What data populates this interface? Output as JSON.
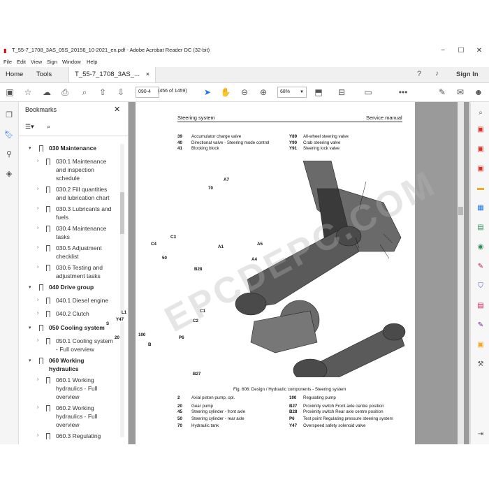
{
  "window": {
    "title": "T_55-7_1708_3AS_05S_20156_10-2021_en.pdf - Adobe Acrobat Reader DC (32-bit)",
    "minimize": "−",
    "maximize": "☐",
    "close": "✕"
  },
  "menu": [
    "File",
    "Edit",
    "View",
    "Sign",
    "Window",
    "Help"
  ],
  "tabs": {
    "home": "Home",
    "tools": "Tools",
    "doc": "T_55-7_1708_3AS_...",
    "doc_close": "×",
    "sign_in": "Sign In"
  },
  "toolbar": {
    "page_num": "090-4",
    "page_count": "(456 of 1459)",
    "zoom": "68%"
  },
  "bookmarks": {
    "title": "Bookmarks",
    "items": [
      {
        "label": "030 Maintenance",
        "level": 1
      },
      {
        "label": "030.1 Maintenance and inspection schedule",
        "level": 2
      },
      {
        "label": "030.2 Fill quantities and lubrication chart",
        "level": 2
      },
      {
        "label": "030.3 Lubricants and fuels",
        "level": 2
      },
      {
        "label": "030.4 Maintenance tasks",
        "level": 2
      },
      {
        "label": "030.5 Adjustment checklist",
        "level": 2
      },
      {
        "label": "030.6 Testing and adjustment tasks",
        "level": 2
      },
      {
        "label": "040 Drive group",
        "level": 1
      },
      {
        "label": "040.1 Diesel engine",
        "level": 2
      },
      {
        "label": "040.2 Clutch",
        "level": 2
      },
      {
        "label": "050 Cooling system",
        "level": 1
      },
      {
        "label": "050.1 Cooling system - Full overview",
        "level": 2
      },
      {
        "label": "060 Working hydraulics",
        "level": 1
      },
      {
        "label": "060.1 Working hydraulics - Full overview",
        "level": 2
      },
      {
        "label": "060.2 Working hydraulics - Full overview",
        "level": 2
      },
      {
        "label": "060.3 Regulating",
        "level": 2
      }
    ]
  },
  "document": {
    "header_left": "Steering system",
    "header_right": "Service manual",
    "top_legend": [
      {
        "code": "39",
        "text": "Accumulator charge valve",
        "code2": "Y89",
        "text2": "All-wheel steering valve"
      },
      {
        "code": "40",
        "text": "Directional valve - Steering mode control",
        "code2": "Y90",
        "text2": "Crab steering valve"
      },
      {
        "code": "41",
        "text": "Blocking block",
        "code2": "Y91",
        "text2": "Steering lock valve"
      }
    ],
    "figure_caption": "Fig. 606: Design / Hydraulic components - Steering system",
    "callouts": [
      "70",
      "A7",
      "A1",
      "A5",
      "A4",
      "C4",
      "C3",
      "B28",
      "C1",
      "C2",
      "L1",
      "Y47",
      "S",
      "20",
      "100",
      "P6",
      "B",
      "B27",
      "50"
    ],
    "bottom_legend": [
      {
        "code": "2",
        "text": "Axial piston pump, opl.",
        "code2": "100",
        "text2": "Regulating pump"
      },
      {
        "code": "20",
        "text": "Gear pump",
        "code2": "B27",
        "text2": "Proximity switch Front axle centre position"
      },
      {
        "code": "45",
        "text": "Steering cylinder - front axle",
        "code2": "B28",
        "text2": "Proximity switch Rear axle centre position"
      },
      {
        "code": "50",
        "text": "Steering cylinder - rear axle",
        "code2": "P6",
        "text2": "Test point Regulating pressure steering system"
      },
      {
        "code": "70",
        "text": "Hydraulic tank",
        "code2": "Y47",
        "text2": "Overspeed safety solenoid valve"
      }
    ],
    "watermark": "EPCDEPC.COM"
  }
}
